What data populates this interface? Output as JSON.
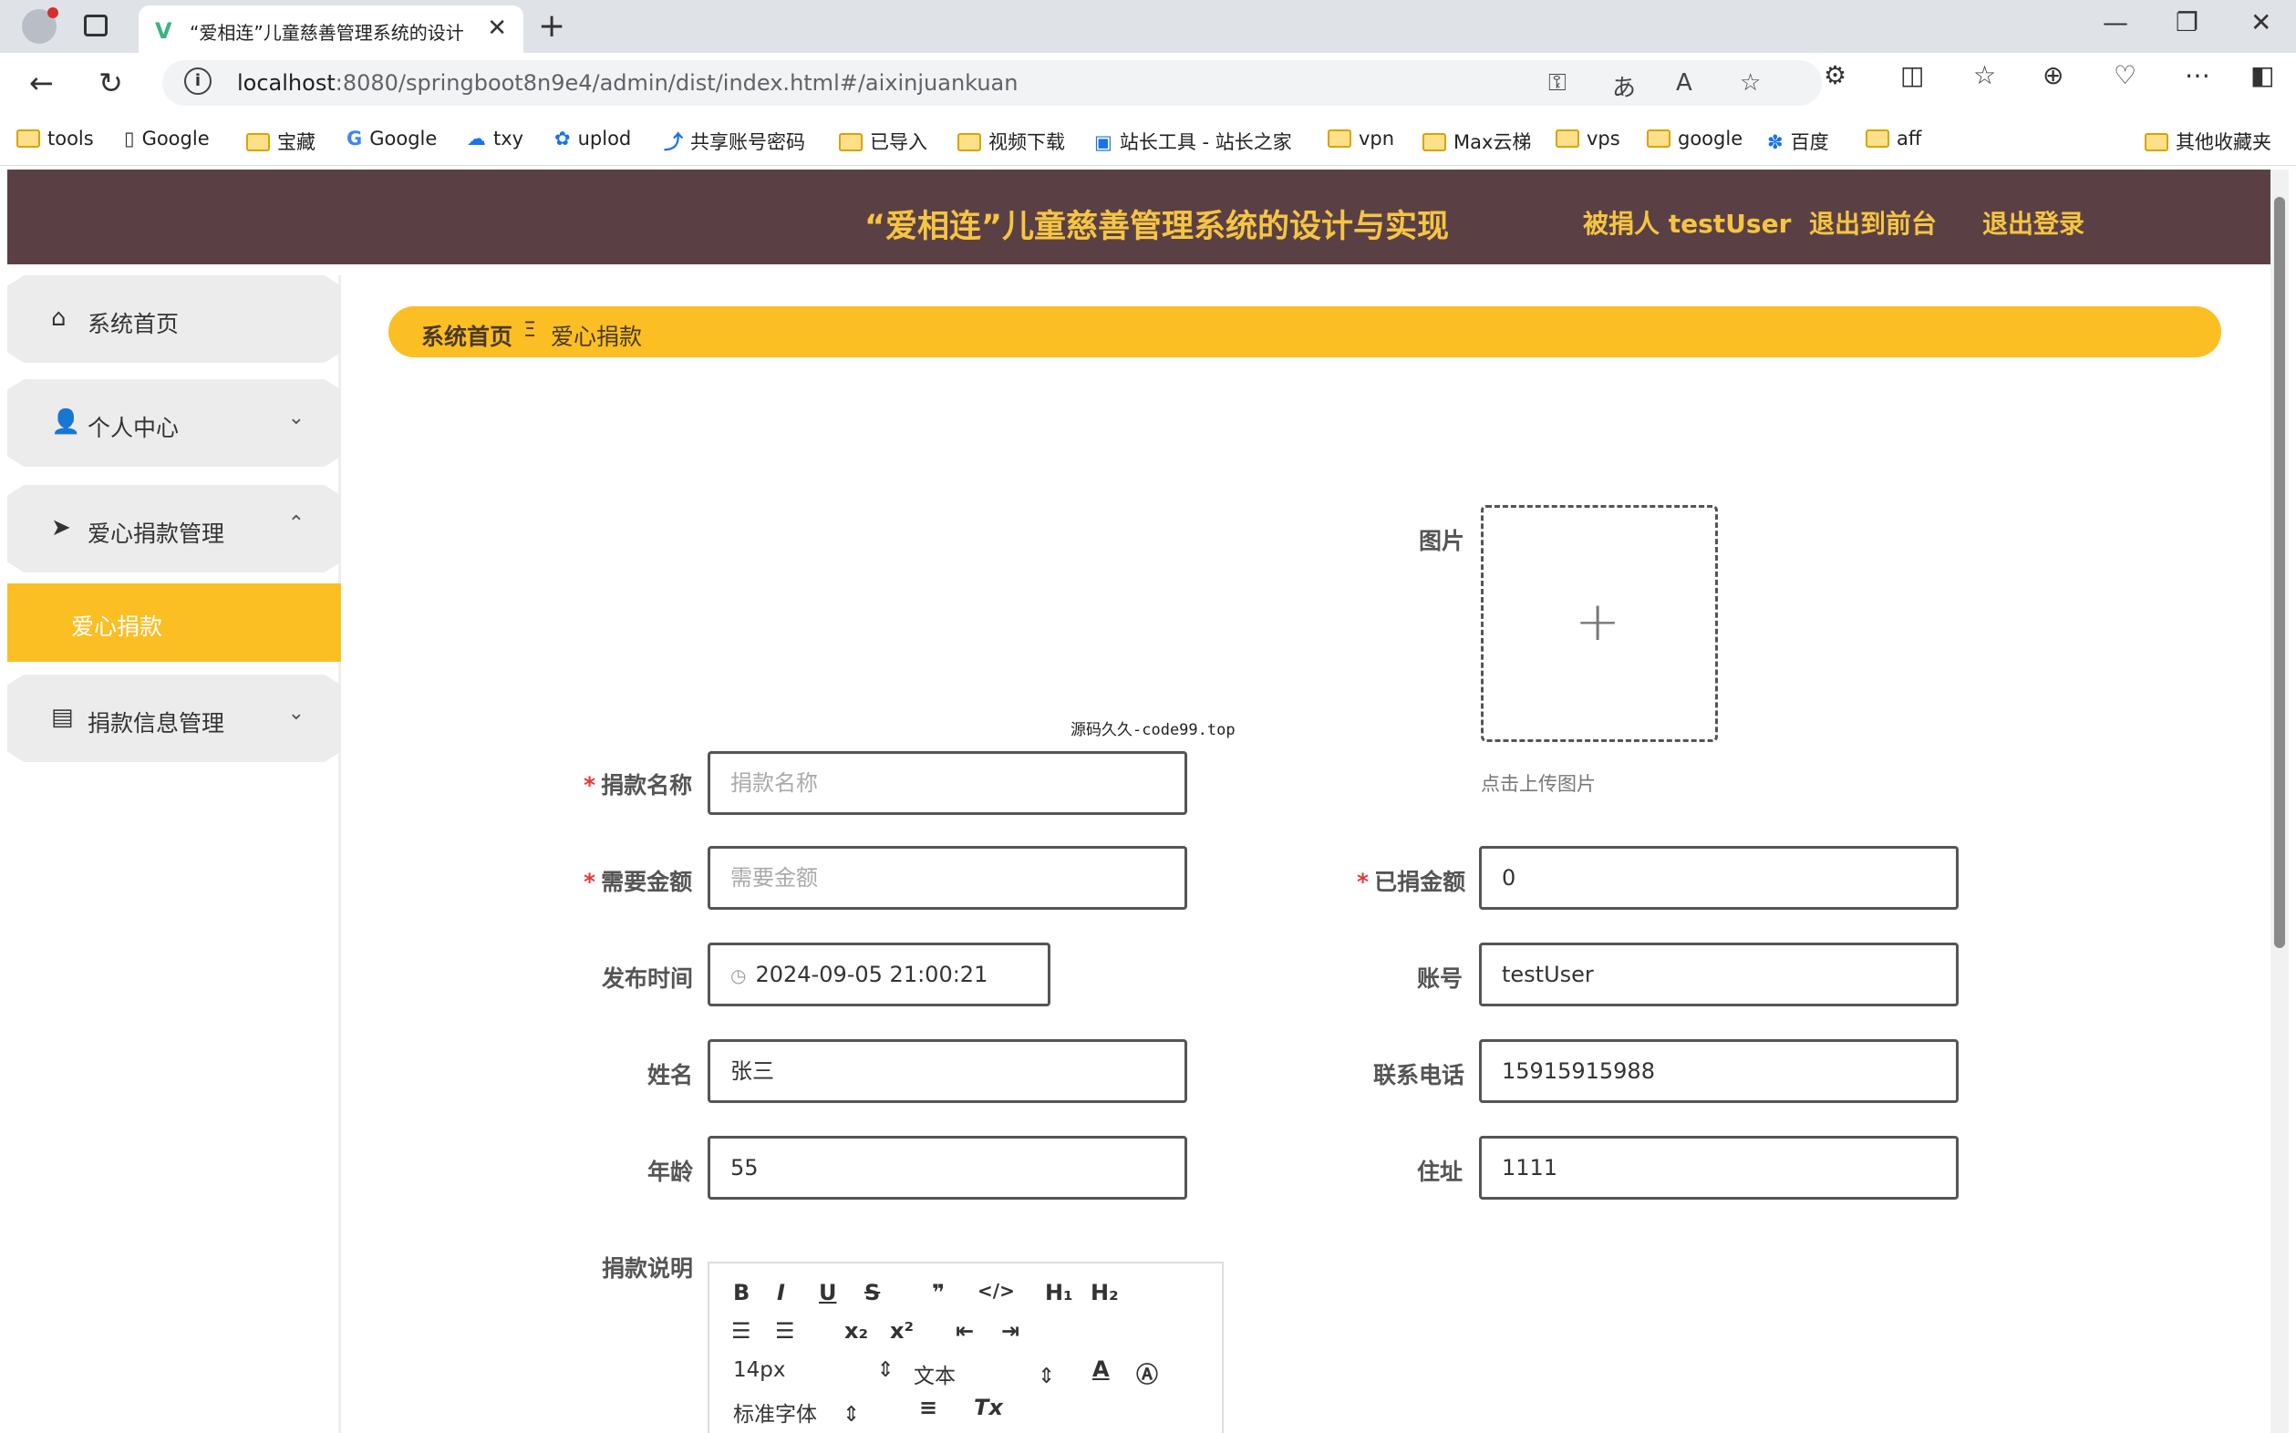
{
  "browser": {
    "tab_title": "“爱相连”儿童慈善管理系统的设计",
    "url_host": "localhost",
    "url_path": ":8080/springboot8n9e4/admin/dist/index.html#/aixinjuankuan",
    "bookmarks": [
      "tools",
      "Google",
      "宝藏",
      "Google",
      "txy",
      "uplod",
      "共享账号密码",
      "已导入",
      "视频下载",
      "站长工具 - 站长之家",
      "vpn",
      "Max云梯",
      "vps",
      "google",
      "百度",
      "aff"
    ],
    "other_bookmarks": "其他收藏夹"
  },
  "header": {
    "title": "“爱相连”儿童慈善管理系统的设计与实现",
    "user": "被捐人 testUser",
    "front": "退出到前台",
    "logout": "退出登录"
  },
  "sidebar": {
    "items": [
      {
        "label": "系统首页",
        "icon": "home-icon"
      },
      {
        "label": "个人中心",
        "icon": "user-icon"
      },
      {
        "label": "爱心捐款管理",
        "icon": "send-icon"
      },
      {
        "label": "捐款信息管理",
        "icon": "clipboard-icon"
      }
    ],
    "active_sub": "爱心捐款"
  },
  "breadcrumb": {
    "home": "系统首页",
    "current": "爱心捐款"
  },
  "form": {
    "image_label": "图片",
    "upload_hint": "点击上传图片",
    "source_tag": "源码久久-code99.top",
    "name_label": "捐款名称",
    "name_placeholder": "捐款名称",
    "need_label": "需要金额",
    "need_placeholder": "需要金额",
    "donated_label": "已捐金额",
    "donated_value": "0",
    "time_label": "发布时间",
    "time_value": "2024-09-05 21:00:21",
    "account_label": "账号",
    "account_value": "testUser",
    "person_label": "姓名",
    "person_value": "张三",
    "phone_label": "联系电话",
    "phone_value": "15915915988",
    "age_label": "年龄",
    "age_value": "55",
    "address_label": "住址",
    "address_value": "1111",
    "desc_label": "捐款说明"
  },
  "editor": {
    "font_size": "14px",
    "block": "文本",
    "font_family": "标准字体"
  }
}
